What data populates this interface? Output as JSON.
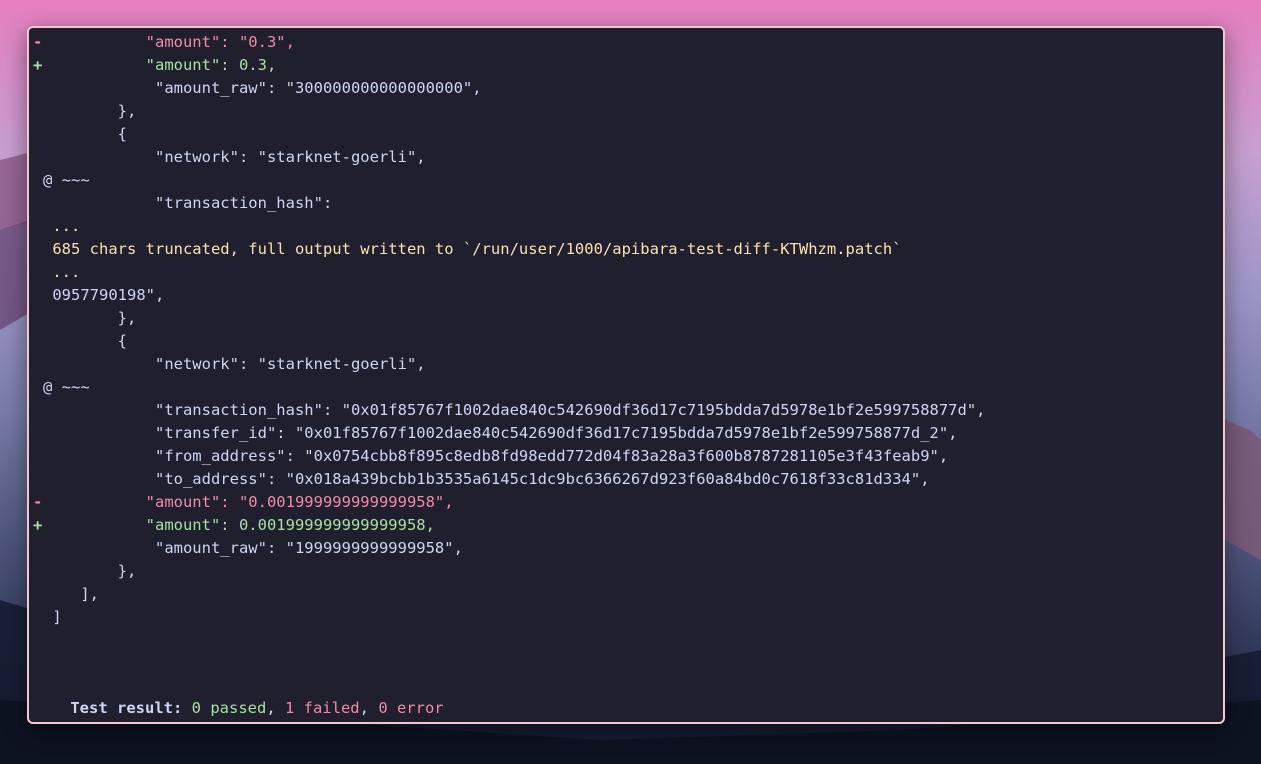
{
  "terminal": {
    "lines": [
      {
        "kind": "removed",
        "gutter": "-",
        "text": "           \"amount\": \"0.3\","
      },
      {
        "kind": "added",
        "gutter": "+",
        "text": "           \"amount\": 0.3,"
      },
      {
        "kind": "plain",
        "gutter": "",
        "text": "            \"amount_raw\": \"300000000000000000\","
      },
      {
        "kind": "plain",
        "gutter": "",
        "text": "        },"
      },
      {
        "kind": "plain",
        "gutter": "",
        "text": "        {"
      },
      {
        "kind": "plain",
        "gutter": "",
        "text": "            \"network\": \"starknet-goerli\","
      },
      {
        "kind": "hunk",
        "gutter": "",
        "text": "@ ~~~"
      },
      {
        "kind": "plain",
        "gutter": "",
        "text": "            \"transaction_hash\":"
      },
      {
        "kind": "dots",
        "gutter": "",
        "text": " ..."
      },
      {
        "kind": "notice",
        "gutter": "",
        "text": " 685 chars truncated, full output written to `/run/user/1000/apibara-test-diff-KTWhzm.patch`"
      },
      {
        "kind": "dots",
        "gutter": "",
        "text": " ..."
      },
      {
        "kind": "plain",
        "gutter": "",
        "text": " 0957790198\","
      },
      {
        "kind": "plain",
        "gutter": "",
        "text": "        },"
      },
      {
        "kind": "plain",
        "gutter": "",
        "text": "        {"
      },
      {
        "kind": "plain",
        "gutter": "",
        "text": "            \"network\": \"starknet-goerli\","
      },
      {
        "kind": "hunk",
        "gutter": "",
        "text": "@ ~~~"
      },
      {
        "kind": "plain",
        "gutter": "",
        "text": "            \"transaction_hash\": \"0x01f85767f1002dae840c542690df36d17c7195bdda7d5978e1bf2e599758877d\","
      },
      {
        "kind": "plain",
        "gutter": "",
        "text": "            \"transfer_id\": \"0x01f85767f1002dae840c542690df36d17c7195bdda7d5978e1bf2e599758877d_2\","
      },
      {
        "kind": "plain",
        "gutter": "",
        "text": "            \"from_address\": \"0x0754cbb8f895c8edb8fd98edd772d04f83a28a3f600b8787281105e3f43feab9\","
      },
      {
        "kind": "plain",
        "gutter": "",
        "text": "            \"to_address\": \"0x018a439bcbb1b3535a6145c1dc9bc6366267d923f60a84bd0c7618f33c81d334\","
      },
      {
        "kind": "removed",
        "gutter": "-",
        "text": "           \"amount\": \"0.001999999999999958\","
      },
      {
        "kind": "added",
        "gutter": "+",
        "text": "           \"amount\": 0.001999999999999958,"
      },
      {
        "kind": "plain",
        "gutter": "",
        "text": "            \"amount_raw\": \"1999999999999958\","
      },
      {
        "kind": "plain",
        "gutter": "",
        "text": "        },"
      },
      {
        "kind": "plain",
        "gutter": "",
        "text": "    ],"
      },
      {
        "kind": "plain",
        "gutter": "",
        "text": " ]"
      }
    ],
    "result": {
      "label": "Test result:",
      "passed": "0 passed",
      "failed": "1 failed",
      "error": "0 error",
      "separator": ", "
    }
  },
  "colors": {
    "removed": "#f38ba8",
    "added": "#a6e3a1",
    "notice": "#f9e2af",
    "text": "#cdd6f4",
    "background": "#1f1f2e",
    "border": "#f2c8cf"
  }
}
